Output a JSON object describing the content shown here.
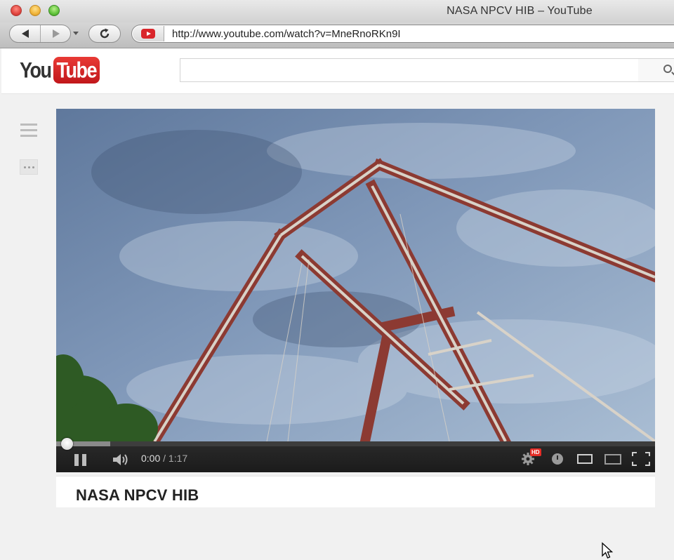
{
  "window": {
    "title": "NASA NPCV HIB – YouTube"
  },
  "browser": {
    "url": "http://www.youtube.com/watch?v=MneRnoRKn9I",
    "back_icon": "back-arrow-icon",
    "forward_icon": "forward-arrow-icon",
    "reload_icon": "reload-icon",
    "favicon": "youtube-favicon-icon"
  },
  "youtube": {
    "logo": {
      "you": "You",
      "tube": "Tube"
    },
    "search": {
      "value": "",
      "placeholder": ""
    },
    "brand_color": "#e52d27"
  },
  "player": {
    "time": {
      "current": "0:00",
      "separator": "/",
      "duration": "1:17"
    },
    "hd_badge": "HD",
    "buffered_fraction": 0.09,
    "played_fraction": 0.0,
    "state": "playing"
  },
  "video": {
    "title": "NASA NPCV HIB"
  }
}
